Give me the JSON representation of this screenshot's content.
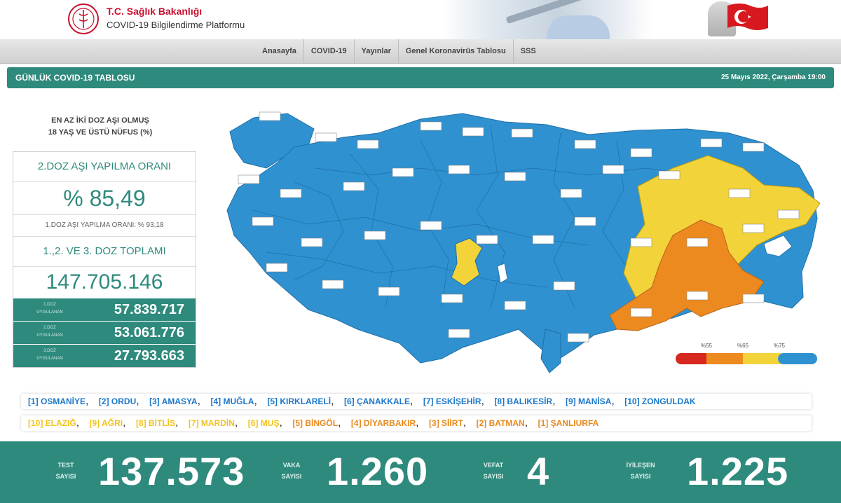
{
  "header": {
    "ministry": "T.C. Sağlık Bakanlığı",
    "platform": "COVID-19 Bilgilendirme Platformu"
  },
  "nav": {
    "items": [
      "Anasayfa",
      "COVID-19",
      "Yayınlar",
      "Genel Koronavirüs Tablosu",
      "SSS"
    ]
  },
  "titlebar": {
    "title": "GÜNLÜK COVID-19 TABLOSU",
    "date": "25 Mayıs 2022, Çarşamba 19:00"
  },
  "vaccine": {
    "heading_line1": "EN AZ İKİ DOZ AŞI OLMUŞ",
    "heading_line2": "18 YAŞ VE ÜSTÜ NÜFUS (%)",
    "second_dose_label": "2.DOZ AŞI YAPILMA ORANI",
    "second_dose_rate": "% 85,49",
    "first_dose_rate_text": "1.DOZ AŞI YAPILMA ORANI: % 93,18",
    "total_label": "1.,2. VE 3. DOZ TOPLAMI",
    "total_value": "147.705.146",
    "doses": [
      {
        "label_line1": "1.DOZ",
        "label_line2": "UYGULANAN",
        "value": "57.839.717"
      },
      {
        "label_line1": "2.DOZ",
        "label_line2": "UYGULANAN",
        "value": "53.061.776"
      },
      {
        "label_line1": "3.DOZ",
        "label_line2": "UYGULANAN",
        "value": "27.793.663"
      }
    ]
  },
  "map": {
    "legend": [
      "%55",
      "%65",
      "%75"
    ],
    "colors": {
      "blue": "#2f91d0",
      "yellow": "#f2d43a",
      "orange": "#ec8a1f",
      "red": "#d6281f",
      "accent": "#2e8a7c"
    }
  },
  "rankings": {
    "highest": [
      "[1] OSMANİYE",
      "[2] ORDU",
      "[3] AMASYA",
      "[4] MUĞLA",
      "[5] KIRKLARELİ",
      "[6] ÇANAKKALE",
      "[7] ESKİŞEHİR",
      "[8] BALIKESİR",
      "[9] MANİSA",
      "[10] ZONGULDAK"
    ],
    "lowest": [
      {
        "text": "[10] ELAZIĞ",
        "color": "#f2c21b"
      },
      {
        "text": "[9] AĞRI",
        "color": "#f2c21b"
      },
      {
        "text": "[8] BİTLİS",
        "color": "#f2c21b"
      },
      {
        "text": "[7] MARDİN",
        "color": "#f2c21b"
      },
      {
        "text": "[6] MUŞ",
        "color": "#f2c21b"
      },
      {
        "text": "[5] BİNGÖL",
        "color": "#e8891d"
      },
      {
        "text": "[4] DİYARBAKIR",
        "color": "#e8891d"
      },
      {
        "text": "[3] SİİRT",
        "color": "#e8891d"
      },
      {
        "text": "[2] BATMAN",
        "color": "#e8891d"
      },
      {
        "text": "[1] ŞANLIURFA",
        "color": "#e8891d"
      }
    ]
  },
  "stats": {
    "test": {
      "label_line1": "TEST",
      "label_line2": "SAYISI",
      "value": "137.573"
    },
    "cases": {
      "label_line1": "VAKA",
      "label_line2": "SAYISI",
      "value": "1.260"
    },
    "deaths": {
      "label_line1": "VEFAT",
      "label_line2": "SAYISI",
      "value": "4"
    },
    "recovered": {
      "label_line1": "İYİLEŞEN",
      "label_line2": "SAYISI",
      "value": "1.225"
    }
  }
}
